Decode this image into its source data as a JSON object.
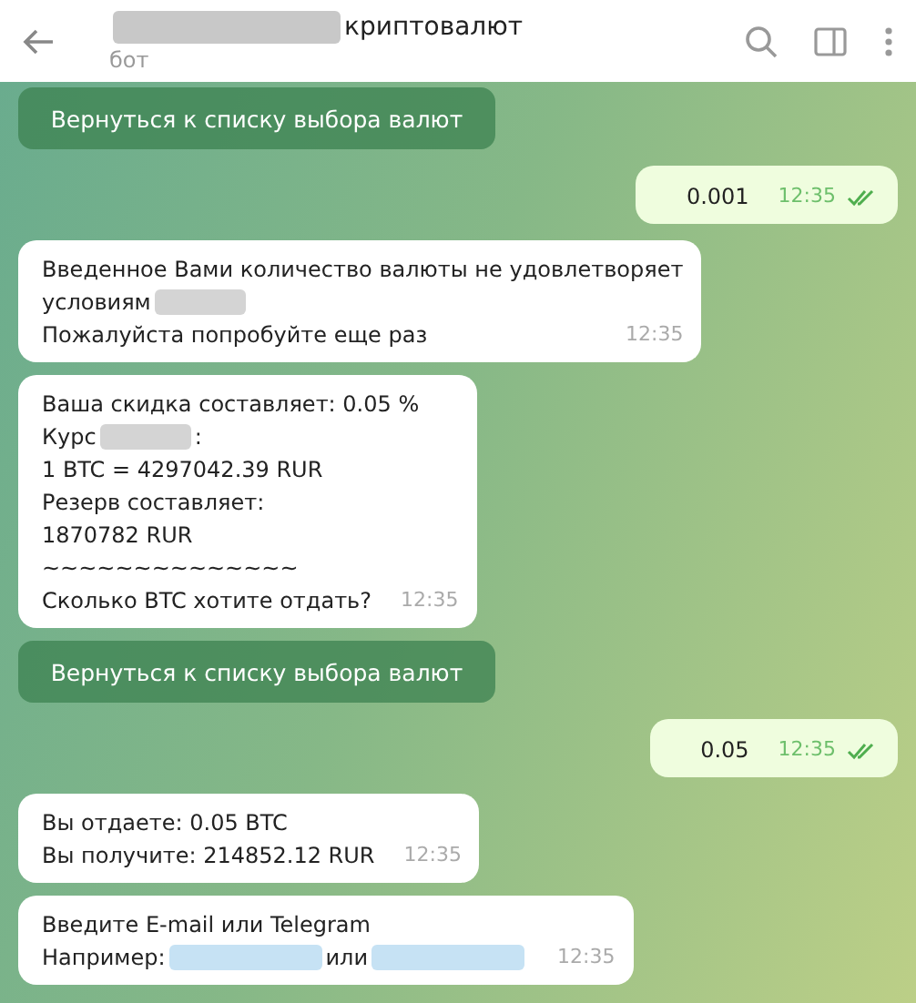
{
  "header": {
    "title": [
      {
        "kind": "blur",
        "color": "#c8c8c8"
      },
      {
        "kind": "text",
        "text": "криптовалют"
      }
    ],
    "subtitle": "бот"
  },
  "messages": [
    {
      "kind": "button",
      "label": "Вернуться к списку выбора валют"
    },
    {
      "kind": "outgoing",
      "lines": [
        [
          {
            "kind": "text",
            "text": "0.001"
          }
        ]
      ],
      "time": "12:35",
      "read": true
    },
    {
      "kind": "incoming",
      "lines": [
        [
          {
            "kind": "text",
            "text": "Введенное Вами количество валюты не удовлетворяет"
          }
        ],
        [
          {
            "kind": "text",
            "text": "условиям"
          },
          {
            "kind": "blur",
            "color": "#d4d4d4"
          }
        ],
        [
          {
            "kind": "text",
            "text": "Пожалуйста попробуйте еще раз"
          }
        ]
      ],
      "time": "12:35"
    },
    {
      "kind": "incoming",
      "lines": [
        [
          {
            "kind": "text",
            "text": "Ваша скидка составляет: 0.05 %"
          }
        ],
        [
          {
            "kind": "text",
            "text": "Курс"
          },
          {
            "kind": "blur",
            "color": "#d4d4d4"
          },
          {
            "kind": "text",
            "text": ":"
          }
        ],
        [
          {
            "kind": "text",
            "text": "1 BTC = 4297042.39 RUR"
          }
        ],
        [
          {
            "kind": "text",
            "text": "Резерв составляет:"
          }
        ],
        [
          {
            "kind": "text",
            "text": "1870782 RUR"
          }
        ],
        [
          {
            "kind": "text",
            "text": "~~~~~~~~~~~~~~"
          }
        ],
        [
          {
            "kind": "text",
            "text": "Сколько BTC хотите отдать?"
          }
        ]
      ],
      "time": "12:35"
    },
    {
      "kind": "button",
      "label": "Вернуться к списку выбора валют"
    },
    {
      "kind": "outgoing",
      "lines": [
        [
          {
            "kind": "text",
            "text": "0.05"
          }
        ]
      ],
      "time": "12:35",
      "read": true
    },
    {
      "kind": "incoming",
      "lines": [
        [
          {
            "kind": "text",
            "text": "Вы отдаете: 0.05 BTC"
          }
        ],
        [
          {
            "kind": "text",
            "text": "Вы получите: 214852.12 RUR"
          }
        ]
      ],
      "time": "12:35"
    },
    {
      "kind": "incoming",
      "lines": [
        [
          {
            "kind": "text",
            "text": "Введите E-mail или Telegram"
          }
        ],
        [
          {
            "kind": "text",
            "text": "Например:"
          },
          {
            "kind": "blur",
            "color": "#c6e2f4"
          },
          {
            "kind": "text",
            "text": "или"
          },
          {
            "kind": "blur",
            "color": "#c6e2f4"
          }
        ]
      ],
      "time": "12:35"
    }
  ]
}
